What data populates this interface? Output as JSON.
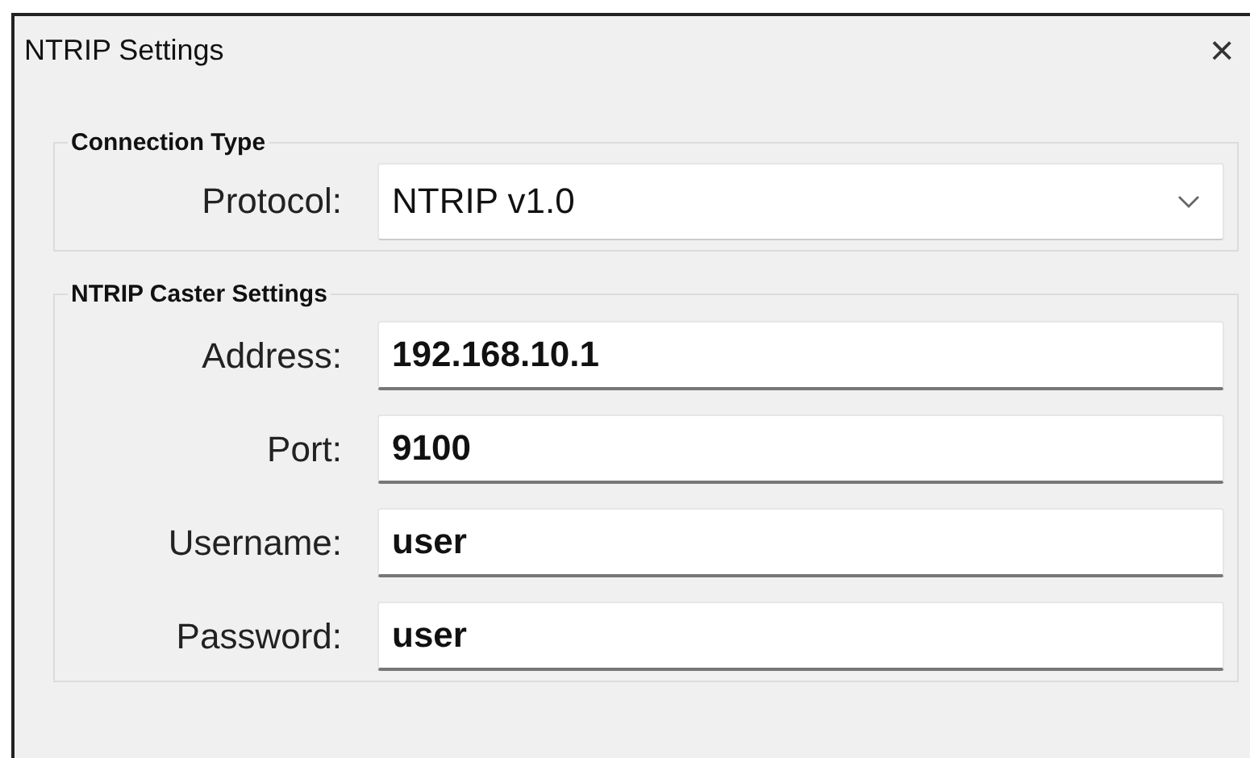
{
  "window": {
    "title": "NTRIP Settings",
    "close": "×"
  },
  "connection_type": {
    "title": "Connection Type",
    "protocol": {
      "label": "Protocol:",
      "value": "NTRIP v1.0"
    }
  },
  "caster_settings": {
    "title": "NTRIP Caster Settings",
    "fields": [
      {
        "label": "Address:",
        "value": "192.168.10.1"
      },
      {
        "label": "Port:",
        "value": "9100"
      },
      {
        "label": "Username:",
        "value": "user"
      },
      {
        "label": "Password:",
        "value": "user"
      }
    ]
  }
}
